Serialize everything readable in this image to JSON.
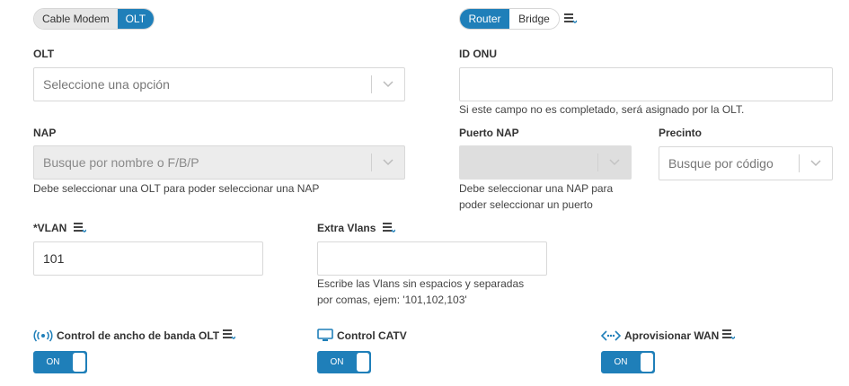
{
  "mode_toggle": {
    "options": [
      "Cable Modem",
      "OLT"
    ],
    "selected": "OLT"
  },
  "net_toggle": {
    "options": [
      "Router",
      "Bridge"
    ],
    "selected": "Router"
  },
  "olt": {
    "label": "OLT",
    "placeholder": "Seleccione una opción"
  },
  "id_onu": {
    "label": "ID ONU",
    "value": "",
    "help": "Si este campo no es completado, será asignado por la OLT."
  },
  "nap": {
    "label": "NAP",
    "placeholder": "Busque por nombre o F/B/P",
    "help": "Debe seleccionar una OLT para poder seleccionar una NAP"
  },
  "puerto_nap": {
    "label": "Puerto NAP",
    "help_line1": "Debe seleccionar una NAP para",
    "help_line2": "poder seleccionar un puerto"
  },
  "precinto": {
    "label": "Precinto",
    "placeholder": "Busque por código"
  },
  "vlan": {
    "label": "*VLAN",
    "value": "101"
  },
  "extra_vlans": {
    "label": "Extra Vlans",
    "value": "",
    "help_line1": "Escribe las Vlans sin espacios y separadas",
    "help_line2": "por comas, ejem: '101,102,103'"
  },
  "controls": {
    "bandwidth": {
      "label": "Control de ancho de banda OLT",
      "state": "ON"
    },
    "catv": {
      "label": "Control CATV",
      "state": "ON"
    },
    "wan": {
      "label": "Aprovisionar WAN",
      "state": "ON"
    }
  },
  "colors": {
    "accent": "#1f7fb9",
    "disabled": "#ececec"
  }
}
